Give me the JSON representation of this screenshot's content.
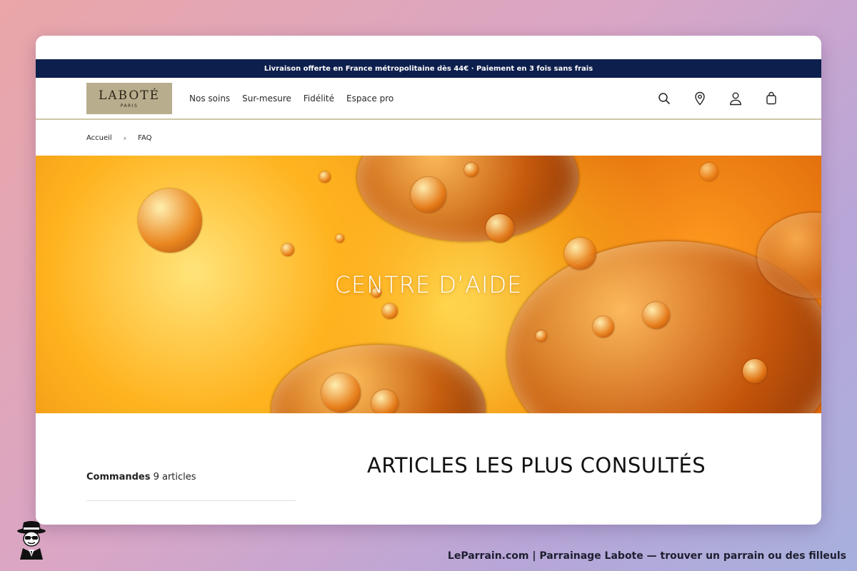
{
  "announcement": "Livraison offerte en France métropolitaine dès 44€ · Paiement en 3 fois sans frais",
  "logo": {
    "name": "LABOTÉ",
    "sub": "PARIS"
  },
  "nav": [
    "Nos soins",
    "Sur-mesure",
    "Fidélité",
    "Espace pro"
  ],
  "icons": [
    "search-icon",
    "location-pin-icon",
    "account-icon",
    "shopping-bag-icon"
  ],
  "breadcrumb": {
    "home": "Accueil",
    "current": "FAQ"
  },
  "hero": {
    "title": "CENTRE D’AIDE"
  },
  "articles": {
    "title": "ARTICLES LES PLUS CONSULTÉS"
  },
  "category": {
    "name": "Commandes",
    "count": "9 articles"
  },
  "caption": "LeParrain.com | Parrainage Labote — trouver un parrain ou des filleuls",
  "colors": {
    "announce_bg": "#0d1f4d",
    "logo_bg": "#b8ae8e",
    "accent_gold": "#cfc6a8"
  }
}
